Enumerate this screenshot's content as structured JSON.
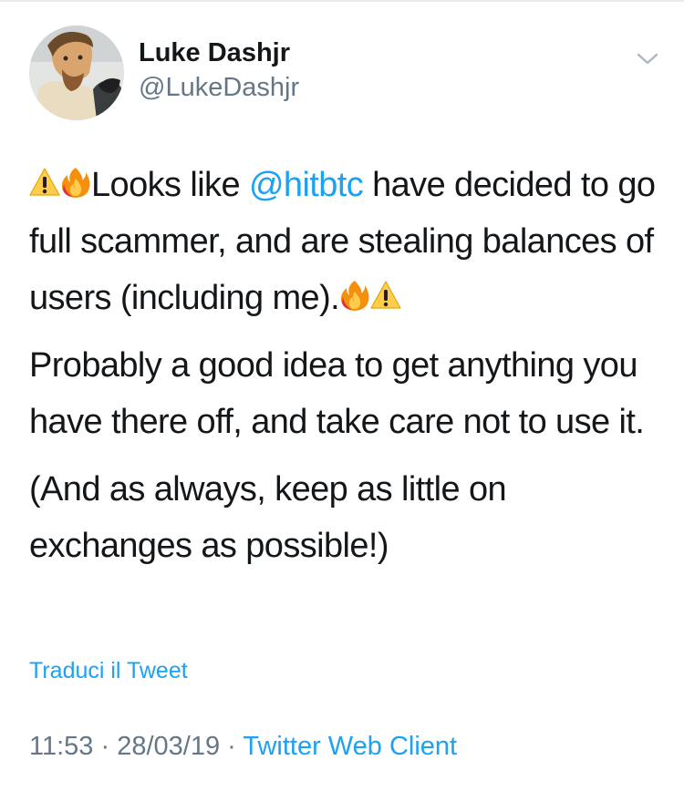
{
  "user": {
    "display_name": "Luke Dashjr",
    "handle": "@LukeDashjr"
  },
  "icons": {
    "more": "chevron-down-icon",
    "warning": "warning-emoji",
    "fire": "fire-emoji"
  },
  "tweet": {
    "p1_text_a": "Looks like ",
    "p1_mention": "@hitbtc",
    "p1_text_b": " have decided to go full scammer, and are stealing balances of users (including me).",
    "p2": "Probably a good idea to get anything you have there off, and take care not to use it.",
    "p3": "(And as always, keep as little on exchanges as possible!)"
  },
  "translate_label": "Traduci il Tweet",
  "meta": {
    "time": "11:53",
    "separator": " · ",
    "date": "28/03/19",
    "client": "Twitter Web Client"
  },
  "colors": {
    "link": "#1da1f2",
    "secondary_text": "#657786",
    "primary_text": "#14171a"
  }
}
